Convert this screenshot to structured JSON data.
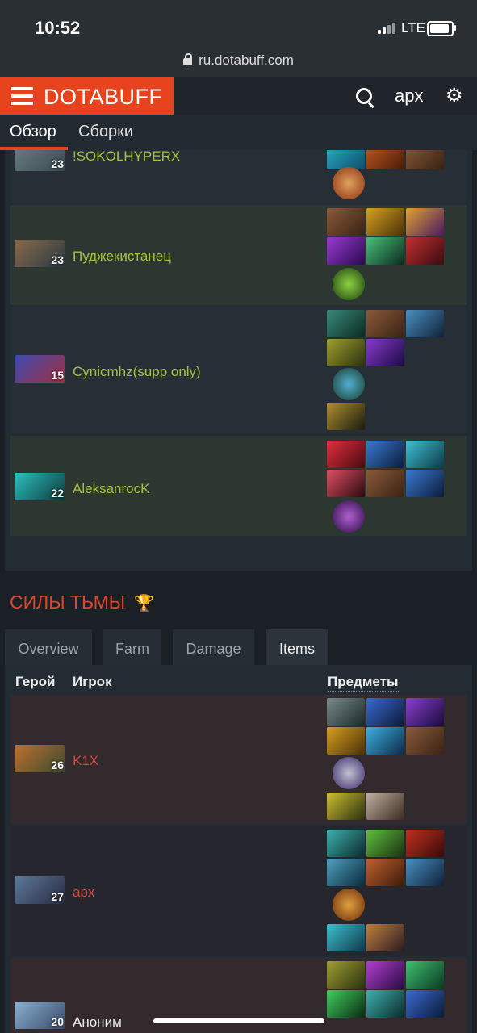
{
  "status_bar": {
    "time": "10:52",
    "network": "LTE"
  },
  "browser": {
    "url": "ru.dotabuff.com"
  },
  "header": {
    "logo": "DOTABUFF",
    "user": "apx",
    "icons": [
      "menu-icon",
      "search-icon",
      "gear-icon"
    ]
  },
  "subnav": {
    "tabs": [
      "Обзор",
      "Сборки"
    ],
    "active": "Обзор"
  },
  "radiant_players": [
    {
      "name": "!SOKOLHYPERX",
      "level": "23"
    },
    {
      "name": "Пуджекистанец",
      "level": "23"
    },
    {
      "name": "Cynicmhz(supp only)",
      "level": "15"
    },
    {
      "name": "AleksanrocK",
      "level": "22"
    }
  ],
  "dire": {
    "title": "СИЛЫ ТЬМЫ",
    "tabs": [
      "Overview",
      "Farm",
      "Damage",
      "Items"
    ],
    "active_tab": "Items",
    "columns": {
      "hero": "Герой",
      "player": "Игрок",
      "items": "Предметы"
    },
    "players": [
      {
        "name": "K1X",
        "level": "26"
      },
      {
        "name": "apx",
        "level": "27"
      },
      {
        "name": "Аноним",
        "level": "20"
      }
    ]
  },
  "colors": {
    "brand": "#e8431f",
    "radiant_name": "#a6c23a",
    "dire_name": "#d2473c"
  }
}
